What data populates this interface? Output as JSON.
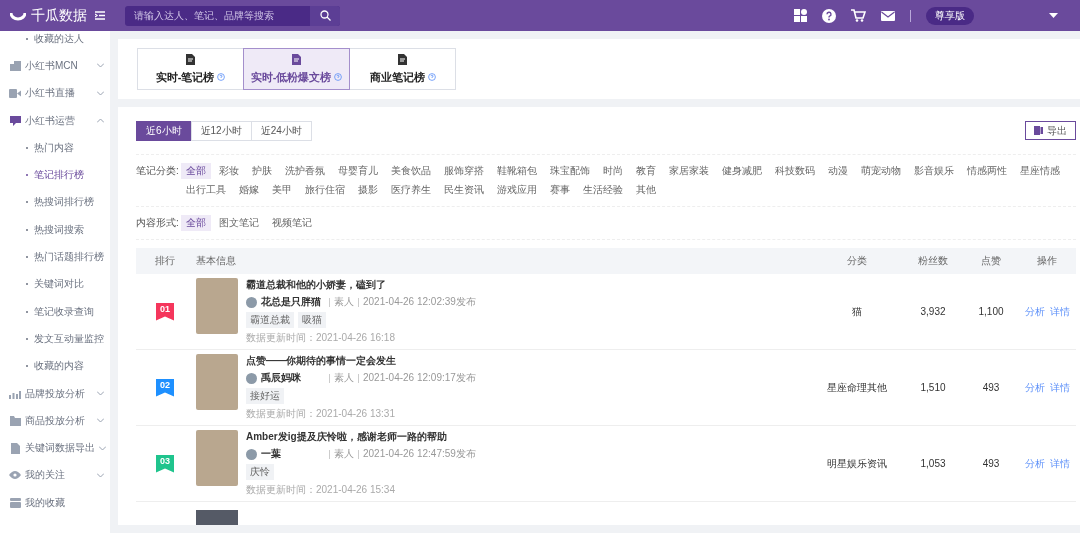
{
  "header": {
    "logo": "千瓜数据",
    "search": {
      "placeholder": "请输入达人、笔记、品牌等搜索"
    },
    "plan": "尊享版"
  },
  "sidebar": {
    "items": [
      {
        "label": "收藏的达人",
        "kind": "sub",
        "selected": false
      },
      {
        "label": "小红书MCN",
        "kind": "group",
        "expanded": false
      },
      {
        "label": "小红书直播",
        "kind": "group",
        "expanded": false
      },
      {
        "label": "小红书运营",
        "kind": "group",
        "expanded": true,
        "children": [
          {
            "label": "热门内容",
            "selected": false
          },
          {
            "label": "笔记排行榜",
            "selected": true
          },
          {
            "label": "热搜词排行榜",
            "selected": false
          },
          {
            "label": "热搜词搜索",
            "selected": false
          },
          {
            "label": "热门话题排行榜",
            "selected": false
          },
          {
            "label": "关键词对比",
            "selected": false
          },
          {
            "label": "笔记收录查询",
            "selected": false
          },
          {
            "label": "发文互动量监控",
            "selected": false
          },
          {
            "label": "收藏的内容",
            "selected": false
          }
        ]
      },
      {
        "label": "品牌投放分析",
        "kind": "group",
        "expanded": false
      },
      {
        "label": "商品投放分析",
        "kind": "group",
        "expanded": false
      },
      {
        "label": "关键词数据导出",
        "kind": "group",
        "expanded": false
      },
      {
        "label": "我的关注",
        "kind": "group",
        "expanded": false
      },
      {
        "label": "我的收藏",
        "kind": "leaf"
      }
    ]
  },
  "report_tabs": [
    {
      "label": "实时-笔记榜",
      "selected": false
    },
    {
      "label": "实时-低粉爆文榜",
      "selected": true
    },
    {
      "label": "商业笔记榜",
      "selected": false
    }
  ],
  "time_tabs": [
    {
      "label": "近6小时",
      "selected": true
    },
    {
      "label": "近12小时",
      "selected": false
    },
    {
      "label": "近24小时",
      "selected": false
    }
  ],
  "export_button": "导出",
  "category_filter": {
    "label": "笔记分类:",
    "options": [
      {
        "label": "全部",
        "selected": true
      },
      {
        "label": "彩妆",
        "selected": false
      },
      {
        "label": "护肤",
        "selected": false
      },
      {
        "label": "洗护香氛",
        "selected": false
      },
      {
        "label": "母婴育儿",
        "selected": false
      },
      {
        "label": "美食饮品",
        "selected": false
      },
      {
        "label": "服饰穿搭",
        "selected": false
      },
      {
        "label": "鞋靴箱包",
        "selected": false
      },
      {
        "label": "珠宝配饰",
        "selected": false
      },
      {
        "label": "时尚",
        "selected": false
      },
      {
        "label": "教育",
        "selected": false
      },
      {
        "label": "家居家装",
        "selected": false
      },
      {
        "label": "健身减肥",
        "selected": false
      },
      {
        "label": "科技数码",
        "selected": false
      },
      {
        "label": "动漫",
        "selected": false
      },
      {
        "label": "萌宠动物",
        "selected": false
      },
      {
        "label": "影音娱乐",
        "selected": false
      },
      {
        "label": "情感两性",
        "selected": false
      },
      {
        "label": "星座情感",
        "selected": false
      },
      {
        "label": "出行工具",
        "selected": false
      },
      {
        "label": "婚嫁",
        "selected": false
      },
      {
        "label": "美甲",
        "selected": false
      },
      {
        "label": "旅行住宿",
        "selected": false
      },
      {
        "label": "摄影",
        "selected": false
      },
      {
        "label": "医疗养生",
        "selected": false
      },
      {
        "label": "民生资讯",
        "selected": false
      },
      {
        "label": "游戏应用",
        "selected": false
      },
      {
        "label": "赛事",
        "selected": false
      },
      {
        "label": "生活经验",
        "selected": false
      },
      {
        "label": "其他",
        "selected": false
      }
    ]
  },
  "format_filter": {
    "label": "内容形式:",
    "options": [
      {
        "label": "全部",
        "selected": true
      },
      {
        "label": "图文笔记",
        "selected": false
      },
      {
        "label": "视频笔记",
        "selected": false
      }
    ]
  },
  "table": {
    "columns": [
      "排行",
      "基本信息",
      "分类",
      "粉丝数",
      "点赞",
      "操作"
    ],
    "rows": [
      {
        "rank": "01",
        "color": "#f5365c",
        "title": "霸道总裁和他的小娇妻，磕到了",
        "author": "花总是只胖猫",
        "author_type": "素人",
        "published": "2021-04-26 12:02:39发布",
        "tags": [
          "霸道总裁",
          "吸猫"
        ],
        "updated": "数据更新时间：2021-04-26 16:18",
        "category": "猫",
        "fans": "3,932",
        "likes": "1,100",
        "actions": [
          "分析",
          "详情"
        ]
      },
      {
        "rank": "02",
        "color": "#1e90ff",
        "title": "点赞——你期待的事情一定会发生",
        "author": "禹辰妈咪",
        "author_type": "素人",
        "published": "2021-04-26 12:09:17发布",
        "tags": [
          "接好运"
        ],
        "updated": "数据更新时间：2021-04-26 13:31",
        "category": "星座命理其他",
        "fans": "1,510",
        "likes": "493",
        "actions": [
          "分析",
          "详情"
        ]
      },
      {
        "rank": "03",
        "color": "#1fc48d",
        "title": "Amber发ig提及庆怜啦，感谢老师一路的帮助",
        "author": "一葉",
        "author_type": "素人",
        "published": "2021-04-26 12:47:59发布",
        "tags": [
          "庆怜"
        ],
        "updated": "数据更新时间：2021-04-26 15:34",
        "category": "明星娱乐资讯",
        "fans": "1,053",
        "likes": "493",
        "actions": [
          "分析",
          "详情"
        ]
      }
    ]
  }
}
